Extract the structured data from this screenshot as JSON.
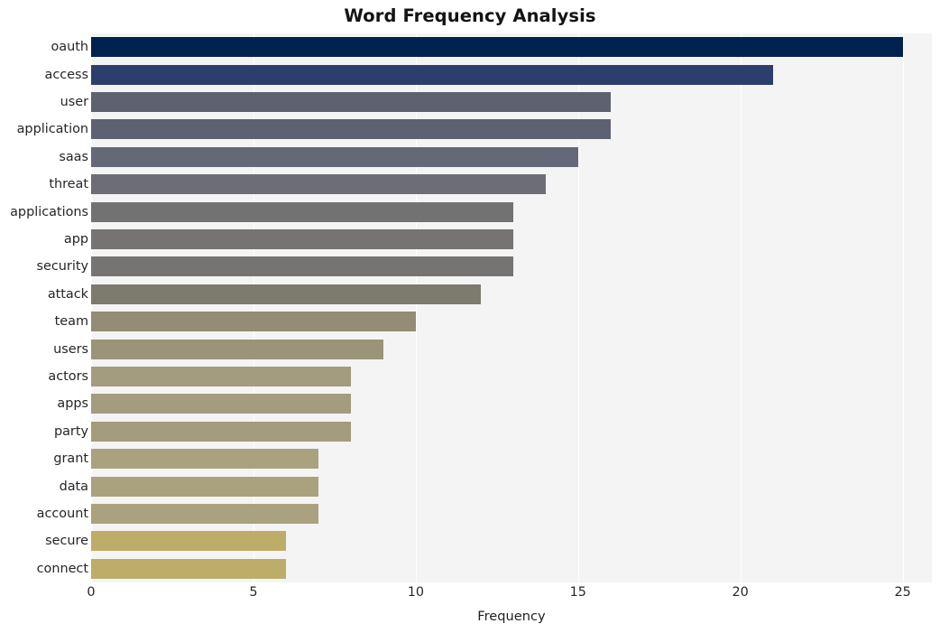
{
  "chart_data": {
    "type": "bar",
    "orientation": "horizontal",
    "title": "Word Frequency Analysis",
    "xlabel": "Frequency",
    "ylabel": "",
    "xlim": [
      0,
      25.9
    ],
    "xticks": [
      0,
      5,
      10,
      15,
      20,
      25
    ],
    "xtick_labels": [
      "0",
      "5",
      "10",
      "15",
      "20",
      "25"
    ],
    "grid": true,
    "grid_axis": "x",
    "grid_color": "#ffffff",
    "plot_background": "#f4f4f4",
    "figure_background": "#ffffff",
    "legend": null,
    "categories": [
      "oauth",
      "access",
      "user",
      "application",
      "saas",
      "threat",
      "applications",
      "app",
      "security",
      "attack",
      "team",
      "users",
      "actors",
      "apps",
      "party",
      "grant",
      "data",
      "account",
      "secure",
      "connect"
    ],
    "values": [
      25,
      21,
      16,
      16,
      15,
      14,
      13,
      13,
      13,
      12,
      10,
      9,
      8,
      8,
      8,
      7,
      7,
      7,
      6,
      6
    ],
    "bar_colors": [
      "#00224e",
      "#2b3e6c",
      "#5d6170",
      "#5d6172",
      "#656877",
      "#6d6e75",
      "#727272",
      "#757472",
      "#757472",
      "#7d7a6e",
      "#928d74",
      "#9a9479",
      "#a39c7e",
      "#a39c7e",
      "#a39c7e",
      "#aaa27f",
      "#aaa27f",
      "#aaa27f",
      "#bdad68",
      "#bdad68"
    ],
    "colormap": "cividis"
  },
  "meta": {
    "title_text": "Word Frequency Analysis"
  }
}
